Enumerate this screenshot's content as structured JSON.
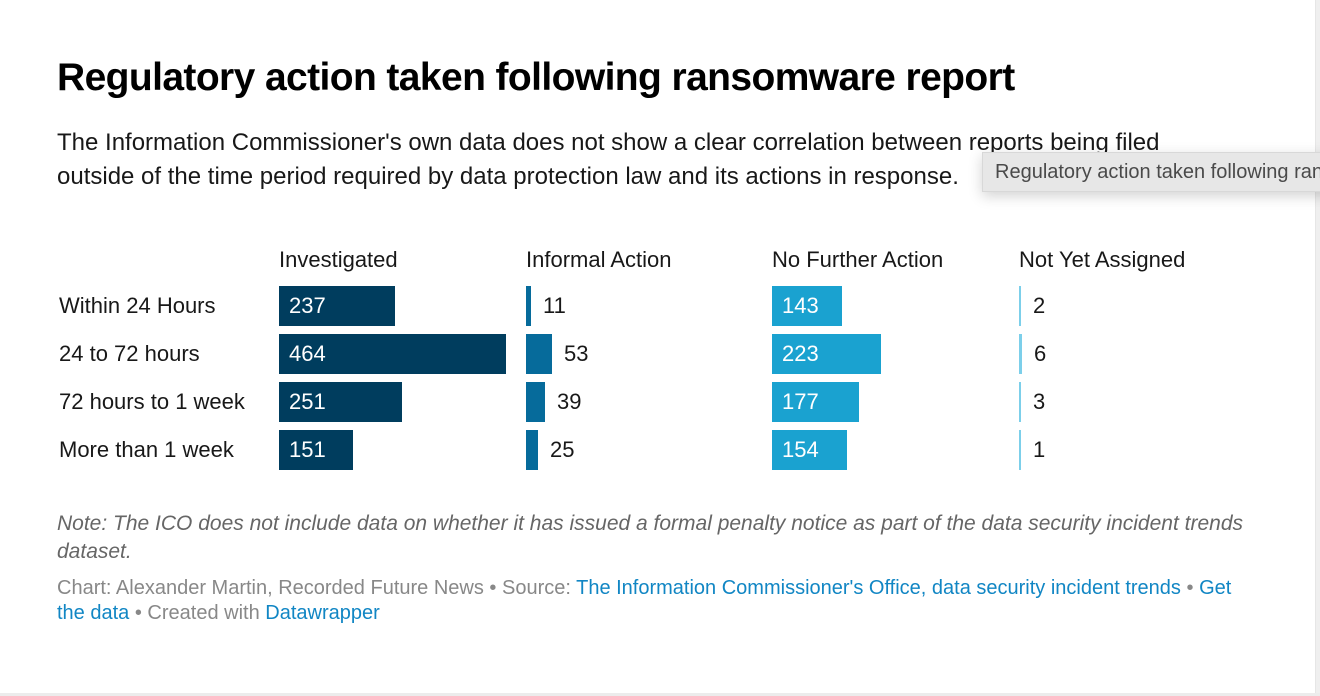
{
  "tooltip": {
    "text": "Regulatory action taken following ransomware report"
  },
  "chart_data": {
    "type": "table",
    "title": "Regulatory action taken following ransomware report",
    "subtitle": "The Information Commissioner's own data does not show a clear correlation between reports being filed outside of the time period required by data protection law and its actions in response.",
    "columns": [
      {
        "name": "Investigated",
        "color": "#003d5e"
      },
      {
        "name": "Informal Action",
        "color": "#066b9b"
      },
      {
        "name": "No Further Action",
        "color": "#1aa2d0"
      },
      {
        "name": "Not Yet Assigned",
        "color": "#7ccfea"
      }
    ],
    "categories": [
      "Within 24 Hours",
      "24 to 72 hours",
      "72 hours to 1 week",
      "More than 1 week"
    ],
    "series": [
      {
        "name": "Investigated",
        "values": [
          237,
          464,
          251,
          151
        ]
      },
      {
        "name": "Informal Action",
        "values": [
          11,
          53,
          39,
          25
        ]
      },
      {
        "name": "No Further Action",
        "values": [
          143,
          223,
          177,
          154
        ]
      },
      {
        "name": "Not Yet Assigned",
        "values": [
          2,
          6,
          3,
          1
        ]
      }
    ],
    "scale_max": 464,
    "note": "Note: The ICO does not include data on whether it has issued a formal penalty notice as part of the data security incident trends dataset."
  },
  "footer": {
    "chart_credit": "Chart: Alexander Martin, Recorded Future News",
    "separator": " • ",
    "source_prefix": "Source: ",
    "source_link": "The Information Commissioner's Office, data security incident trends",
    "get_data_link": "Get the data",
    "created_with_prefix": "Created with ",
    "created_with_link": "Datawrapper"
  }
}
